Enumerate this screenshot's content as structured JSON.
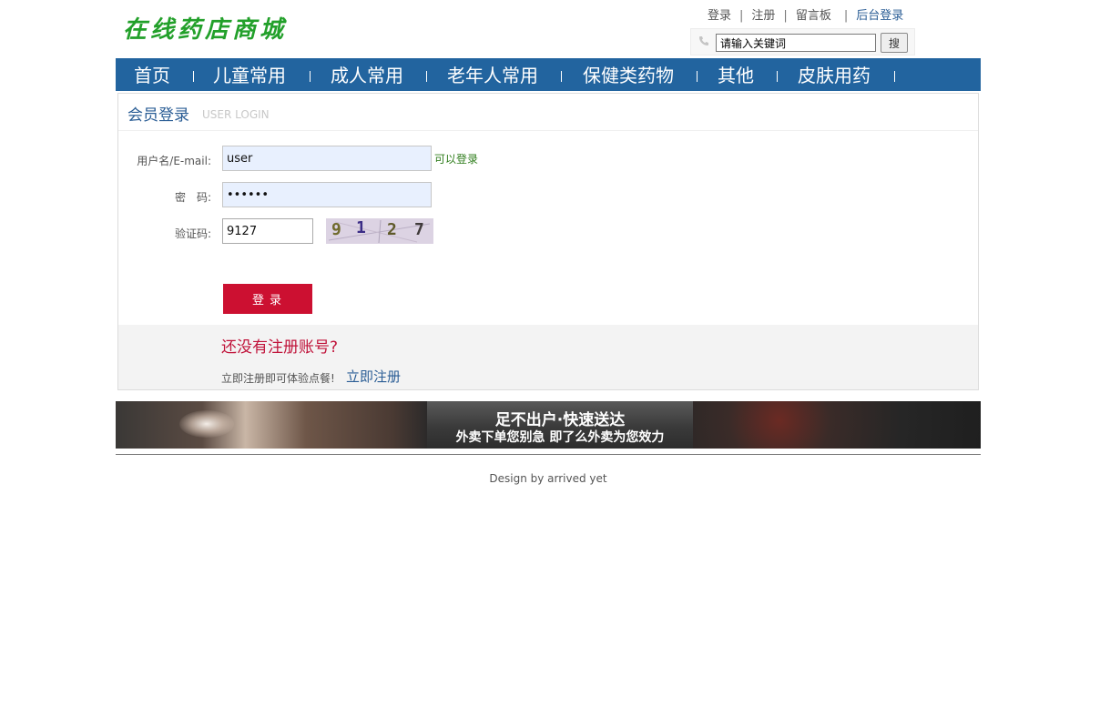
{
  "site": {
    "logo_text": "在线药店商城"
  },
  "top_links": [
    {
      "label": "登录"
    },
    {
      "label": "注册"
    },
    {
      "label": "留言板"
    },
    {
      "label": "后台登录"
    }
  ],
  "top_links_sep": "|",
  "search": {
    "value": "请输入关键词",
    "button_label": "搜"
  },
  "nav": {
    "items": [
      "首页",
      "儿童常用",
      "成人常用",
      "老年人常用",
      "保健类药物",
      "其他",
      "皮肤用药"
    ]
  },
  "login": {
    "title": "会员登录",
    "subtitle": "USER LOGIN",
    "username_label": "用户名/E-mail:",
    "username_value": "user",
    "username_hint": "可以登录",
    "password_label": "密　码:",
    "password_value": "••••••",
    "captcha_label": "验证码:",
    "captcha_value": "9127",
    "captcha_image_digits": [
      "9",
      "1",
      "2",
      "7"
    ],
    "submit_label": "登录",
    "register_title": "还没有注册账号?",
    "register_text": "立即注册即可体验点餐!",
    "register_link": "立即注册"
  },
  "banner": {
    "line1": "足不出户·快速送达",
    "line2": "外卖下单您别急 即了么外卖为您效力"
  },
  "footer": {
    "text": "Design by arrived yet"
  },
  "colors": {
    "nav_bg": "#22649f",
    "logo": "#22a02a",
    "login_button": "#cc1031",
    "register_title": "#c0133a",
    "link_blue": "#2a5d95"
  }
}
